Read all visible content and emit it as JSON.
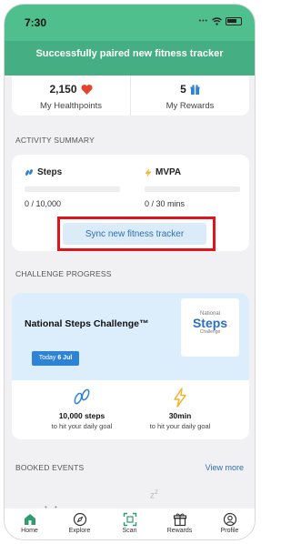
{
  "status": {
    "time": "7:30"
  },
  "toast": {
    "message": "Successfully paired new fitness tracker"
  },
  "points": {
    "healthpoints_value": "2,150",
    "healthpoints_label": "My Healthpoints",
    "rewards_value": "5",
    "rewards_label": "My Rewards"
  },
  "activity": {
    "section_title": "ACTIVITY SUMMARY",
    "steps_label": "Steps",
    "steps_value": "0 / 10,000",
    "mvpa_label": "MVPA",
    "mvpa_value": "0 / 30 mins",
    "sync_button": "Sync new fitness tracker"
  },
  "challenge": {
    "section_title": "CHALLENGE PROGRESS",
    "title": "National Steps Challenge™",
    "logo_line1": "National",
    "logo_line2": "Steps",
    "logo_line3": "Challenge",
    "today_label": "Today",
    "today_date": "6 Jul",
    "goal1_value": "10,000 steps",
    "goal1_sub": "to hit your daily goal",
    "goal2_value": "30min",
    "goal2_sub": "to hit your daily goal"
  },
  "events": {
    "section_title": "BOOKED EVENTS",
    "view_more": "View more"
  },
  "tabs": [
    {
      "label": "Home"
    },
    {
      "label": "Explore"
    },
    {
      "label": "Scan"
    },
    {
      "label": "Rewards"
    },
    {
      "label": "Profile"
    }
  ],
  "colors": {
    "accent_green": "#4fbf8e",
    "link_blue": "#2d6fb3",
    "highlight_red": "#e1141c",
    "heart_red": "#e4432c"
  }
}
